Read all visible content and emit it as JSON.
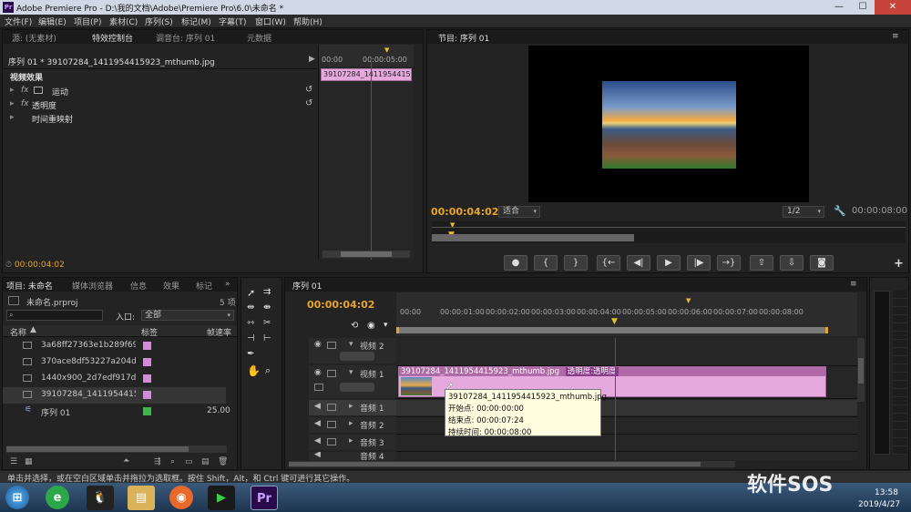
{
  "window": {
    "logo": "Pr",
    "title": "Adobe Premiere Pro - D:\\我的文档\\Adobe\\Premiere Pro\\6.0\\未命名 *",
    "minimize": "—",
    "maximize": "☐",
    "close": "✕"
  },
  "menu": [
    "文件(F)",
    "编辑(E)",
    "项目(P)",
    "素材(C)",
    "序列(S)",
    "标记(M)",
    "字幕(T)",
    "窗口(W)",
    "帮助(H)"
  ],
  "effect_controls": {
    "tabs": [
      "源: (无素材)",
      "特效控制台",
      "调音台: 序列 01",
      "元数据"
    ],
    "header": "序列 01 * 39107284_1411954415923_mthumb.jpg",
    "section": "视频效果",
    "effects": [
      "运动",
      "透明度",
      "时间重映射"
    ],
    "fx_label": "fx",
    "mini_ruler": [
      "00:00",
      "00:00:05:00"
    ],
    "clip_label": "39107284_1411954415923_",
    "timecode": "00:00:04:02"
  },
  "program_monitor": {
    "tab": "节目: 序列 01",
    "timecode": "00:00:04:02",
    "fit": "适合",
    "resolution": "1/2",
    "duration": "00:00:08:00",
    "transport": [
      "●",
      "{",
      "}",
      "{←",
      "◀|",
      "▶",
      "|▶",
      "→}",
      "⇧",
      "⇩",
      "◙"
    ],
    "add": "+"
  },
  "project": {
    "tabs": [
      "项目: 未命名",
      "媒体浏览器",
      "信息",
      "效果",
      "标记"
    ],
    "name": "未命名.prproj",
    "count": "5 项",
    "search_placeholder": "",
    "in_label": "入口:",
    "in_value": "全部",
    "columns": [
      "名称",
      "标签",
      "帧速率"
    ],
    "items": [
      {
        "name": "3a68ff27363e1b289f69628",
        "color": "#d38ad9",
        "rate": ""
      },
      {
        "name": "370ace8df53227a204d64c7",
        "color": "#d38ad9",
        "rate": ""
      },
      {
        "name": "1440x900_2d7edf917d2889",
        "color": "#d38ad9",
        "rate": ""
      },
      {
        "name": "39107284_1411954415923_",
        "color": "#d38ad9",
        "rate": ""
      },
      {
        "name": "序列 01",
        "color": "#3cb84a",
        "rate": "25.00"
      }
    ]
  },
  "timeline": {
    "tab": "序列 01",
    "timecode": "00:00:04:02",
    "ruler": [
      "00:00",
      "00:00:01:00",
      "00:00:02:00",
      "00:00:03:00",
      "00:00:04:00",
      "00:00:05:00",
      "00:00:06:00",
      "00:00:07:00",
      "00:00:08:00"
    ],
    "tracks": {
      "video2": "视频 2",
      "video1": "视频 1",
      "audio1": "音频 1",
      "audio2": "音频 2",
      "audio3": "音频 3",
      "audio4": "音频 4"
    },
    "clip_name": "39107284_1411954415923_mthumb.jpg",
    "clip_fx": "透明度:透明度",
    "tooltip": {
      "title": "39107284_1411954415923_mthumb.jpg",
      "start": "开始点: 00:00:00:00",
      "end": "结束点: 00:00:07:24",
      "duration": "持续时间: 00:00:08:00"
    }
  },
  "status": "单击并选择，或在空白区域单击并拖拉为选取框。按住 Shift，Alt，和 Ctrl 键可进行其它操作。",
  "taskbar": {
    "clock": "13:58",
    "date": "2019/4/27",
    "watermark": "软件SOS",
    "premiere": "Pr"
  }
}
